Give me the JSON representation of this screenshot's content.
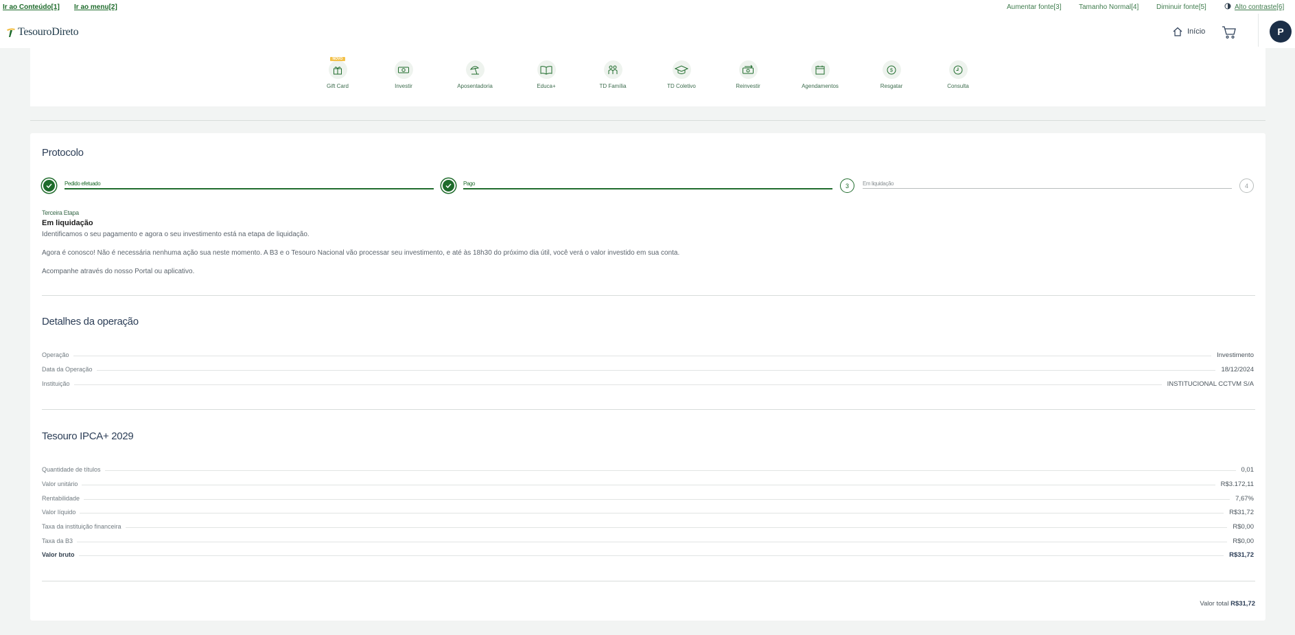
{
  "accessibility": {
    "skip_content": "Ir ao Conteúdo[1]",
    "skip_menu": "Ir ao menu[2]",
    "font_increase": "Aumentar fonte[3]",
    "font_normal": "Tamanho Normal[4]",
    "font_decrease": "Diminuir fonte[5]",
    "high_contrast": "Alto contraste[6]"
  },
  "header": {
    "logo_text": "TesouroDireto",
    "home_label": "Início",
    "avatar_initial": "P"
  },
  "menu": {
    "badge_new": "NOVO",
    "items": [
      {
        "label": "Gift Card",
        "icon": "gift-icon"
      },
      {
        "label": "Investir",
        "icon": "money-icon"
      },
      {
        "label": "Aposentadoria",
        "icon": "beach-umbrella-icon"
      },
      {
        "label": "Educa+",
        "icon": "book-icon"
      },
      {
        "label": "TD Família",
        "icon": "family-icon"
      },
      {
        "label": "TD Coletivo",
        "icon": "graduation-cap-icon"
      },
      {
        "label": "Reinvestir",
        "icon": "reinvest-icon"
      },
      {
        "label": "Agendamentos",
        "icon": "calendar-icon"
      },
      {
        "label": "Resgatar",
        "icon": "coin-icon"
      },
      {
        "label": "Consulta",
        "icon": "clock-icon"
      }
    ]
  },
  "protocol": {
    "title": "Protocolo",
    "steps": [
      {
        "label": "Pedido efetuado",
        "state": "done"
      },
      {
        "label": "Pago",
        "state": "done"
      },
      {
        "number": "3",
        "label": "Em liquidação",
        "state": "current"
      },
      {
        "number": "4",
        "state": "pending"
      }
    ],
    "stage_small": "Terceira Etapa",
    "stage_title": "Em liquidação",
    "paragraphs": [
      "Identificamos o seu pagamento e agora o seu investimento está na etapa de liquidação.",
      "Agora é conosco! Não é necessária nenhuma ação sua neste momento. A B3 e o Tesouro Nacional vão processar seu investimento, e até às 18h30 do próximo dia útil, você verá o valor investido em sua conta.",
      "Acompanhe através do nosso Portal ou aplicativo."
    ]
  },
  "operation": {
    "title": "Detalhes da operação",
    "rows": [
      {
        "label": "Operação",
        "value": "Investimento"
      },
      {
        "label": "Data da Operação",
        "value": "18/12/2024"
      },
      {
        "label": "Instituição",
        "value": "INSTITUCIONAL CCTVM S/A"
      }
    ]
  },
  "bond": {
    "title": "Tesouro IPCA+ 2029",
    "rows": [
      {
        "label": "Quantidade de títulos",
        "value": "0,01"
      },
      {
        "label": "Valor unitário",
        "value": "R$3.172,11"
      },
      {
        "label": "Rentabilidade",
        "value": "7,67%"
      },
      {
        "label": "Valor líquido",
        "value": "R$31,72"
      },
      {
        "label": "Taxa da instituição financeira",
        "value": "R$0,00"
      },
      {
        "label": "Taxa da B3",
        "value": "R$0,00"
      },
      {
        "label": "Valor bruto",
        "value": "R$31,72"
      }
    ],
    "total_label": "Valor total",
    "total_value": "R$31,72"
  },
  "colors": {
    "brand_green": "#1e6b2b",
    "navy": "#1b2e47",
    "badge_yellow": "#f3c14a"
  }
}
